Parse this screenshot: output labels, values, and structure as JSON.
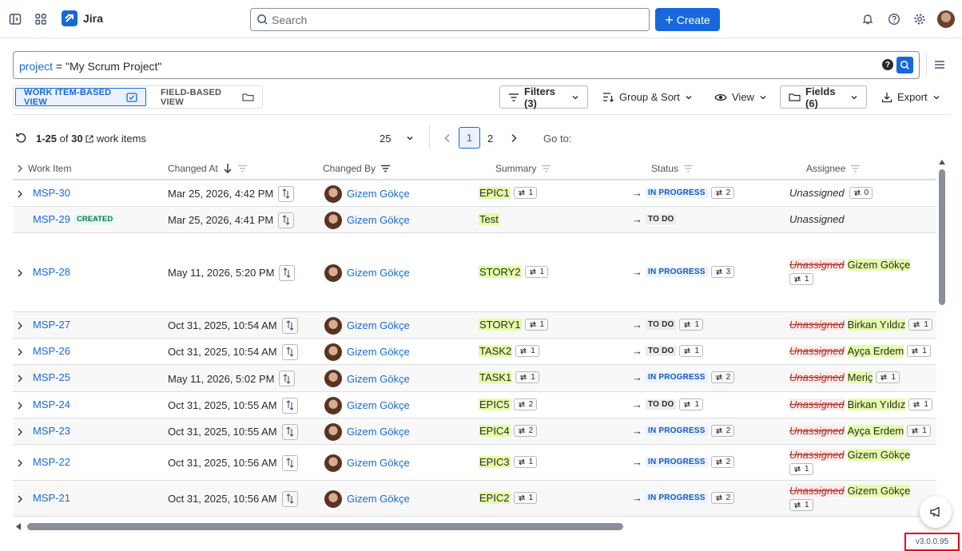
{
  "app": {
    "name": "Jira"
  },
  "search": {
    "placeholder": "Search"
  },
  "create_label": "Create",
  "jql": {
    "keyword": "project",
    "operator": "=",
    "value": "\"My Scrum Project\""
  },
  "view_switch": {
    "item_view": "WORK ITEM-BASED VIEW",
    "field_view": "FIELD-BASED VIEW"
  },
  "toolbar": {
    "filters": "Filters (3)",
    "group_sort": "Group & Sort",
    "view": "View",
    "fields": "Fields (6)",
    "export": "Export"
  },
  "pagination": {
    "range": "1-25",
    "of": "of",
    "total": "30",
    "suffix": "work items",
    "page_size": "25",
    "page1": "1",
    "page2": "2",
    "goto": "Go to:"
  },
  "columns": {
    "work_item": "Work Item",
    "changed_at": "Changed At",
    "changed_by": "Changed By",
    "summary": "Summary",
    "status": "Status",
    "assignee": "Assignee"
  },
  "rows": [
    {
      "key": "MSP-30",
      "created": "",
      "changed_at": "Mar 25, 2026, 4:42 PM",
      "changed_by": "Gizem Gökçe",
      "summary": "EPIC1",
      "summary_count": "1",
      "status": "IN PROGRESS",
      "status_count": "2",
      "assignee_old": "",
      "assignee": "Unassigned",
      "assignee_count": "0"
    },
    {
      "key": "MSP-29",
      "created": "CREATED",
      "changed_at": "Mar 25, 2026, 4:41 PM",
      "changed_by": "Gizem Gökçe",
      "summary": "Test",
      "summary_count": "",
      "status": "TO DO",
      "status_count": "",
      "assignee_old": "",
      "assignee": "Unassigned",
      "assignee_count": ""
    },
    {
      "key": "MSP-28",
      "created": "",
      "changed_at": "May 11, 2026, 5:20 PM",
      "changed_by": "Gizem Gökçe",
      "summary": "STORY2",
      "summary_count": "1",
      "status": "IN PROGRESS",
      "status_count": "3",
      "assignee_old": "Unassigned",
      "assignee": "Gizem Gökçe",
      "assignee_count": "1"
    },
    {
      "key": "MSP-27",
      "created": "",
      "changed_at": "Oct 31, 2025, 10:54 AM",
      "changed_by": "Gizem Gökçe",
      "summary": "STORY1",
      "summary_count": "1",
      "status": "TO DO",
      "status_count": "1",
      "assignee_old": "Unassigned",
      "assignee": "Birkan Yıldız",
      "assignee_count": "1"
    },
    {
      "key": "MSP-26",
      "created": "",
      "changed_at": "Oct 31, 2025, 10:54 AM",
      "changed_by": "Gizem Gökçe",
      "summary": "TASK2",
      "summary_count": "1",
      "status": "TO DO",
      "status_count": "1",
      "assignee_old": "Unassigned",
      "assignee": "Ayça Erdem",
      "assignee_count": "1"
    },
    {
      "key": "MSP-25",
      "created": "",
      "changed_at": "May 11, 2026, 5:02 PM",
      "changed_by": "Gizem Gökçe",
      "summary": "TASK1",
      "summary_count": "1",
      "status": "IN PROGRESS",
      "status_count": "2",
      "assignee_old": "Unassigned",
      "assignee": "Meriç",
      "assignee_count": "1"
    },
    {
      "key": "MSP-24",
      "created": "",
      "changed_at": "Oct 31, 2025, 10:55 AM",
      "changed_by": "Gizem Gökçe",
      "summary": "EPIC5",
      "summary_count": "2",
      "status": "TO DO",
      "status_count": "1",
      "assignee_old": "Unassigned",
      "assignee": "Birkan Yıldız",
      "assignee_count": "1"
    },
    {
      "key": "MSP-23",
      "created": "",
      "changed_at": "Oct 31, 2025, 10:55 AM",
      "changed_by": "Gizem Gökçe",
      "summary": "EPIC4",
      "summary_count": "2",
      "status": "IN PROGRESS",
      "status_count": "2",
      "assignee_old": "Unassigned",
      "assignee": "Ayça Erdem",
      "assignee_count": "1"
    },
    {
      "key": "MSP-22",
      "created": "",
      "changed_at": "Oct 31, 2025, 10:56 AM",
      "changed_by": "Gizem Gökçe",
      "summary": "EPIC3",
      "summary_count": "1",
      "status": "IN PROGRESS",
      "status_count": "2",
      "assignee_old": "Unassigned",
      "assignee": "Gizem Gökçe",
      "assignee_count": "1"
    },
    {
      "key": "MSP-21",
      "created": "",
      "changed_at": "Oct 31, 2025, 10:56 AM",
      "changed_by": "Gizem Gökçe",
      "summary": "EPIC2",
      "summary_count": "1",
      "status": "IN PROGRESS",
      "status_count": "2",
      "assignee_old": "Unassigned",
      "assignee": "Gizem Gökçe",
      "assignee_count": "1"
    }
  ],
  "version": "v3.0.0.95",
  "colors": {
    "brand": "#1868db",
    "in_progress_bg": "#e9f2fe",
    "highlight": "#e5fca8",
    "removed": "#ffeceb",
    "version_border": "#e2001a"
  }
}
